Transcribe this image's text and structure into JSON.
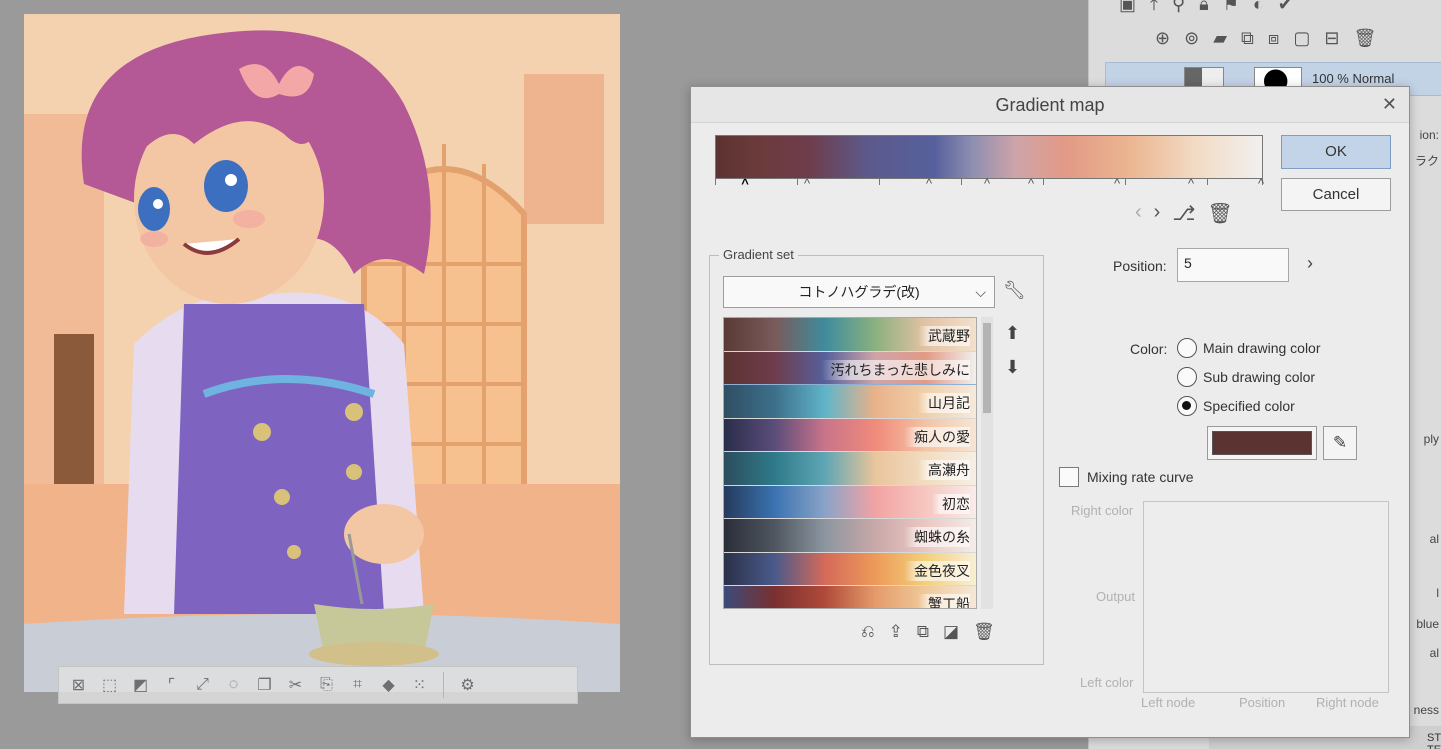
{
  "dialog": {
    "title": "Gradient map",
    "close_label": "✕",
    "ok_label": "OK",
    "cancel_label": "Cancel",
    "node_tools": {
      "prev": "‹",
      "next": "›",
      "add_icon": "add-node-icon",
      "delete_icon": "delete-node-icon"
    },
    "gradient_set": {
      "legend": "Gradient set",
      "selected_set": "コトノハグラデ(改)",
      "items": [
        {
          "label": "武蔵野",
          "colors": [
            "#5a3a35",
            "#7a5a5a",
            "#3f8c9d",
            "#8bb07f",
            "#e3c2a3",
            "#f2e1cc"
          ]
        },
        {
          "label": "汚れちまった悲しみに",
          "colors": [
            "#5b3331",
            "#6e3d4c",
            "#56609c",
            "#cfa4a8",
            "#e29a86",
            "#f1f0ee"
          ]
        },
        {
          "label": "山月記",
          "colors": [
            "#2f4f63",
            "#3d6f8a",
            "#5fb4c8",
            "#eab28a",
            "#f0cfa9",
            "#f5eadc"
          ]
        },
        {
          "label": "痴人の愛",
          "colors": [
            "#2a2d4a",
            "#5a4d7a",
            "#c9748a",
            "#f08b7b",
            "#f3c3a4",
            "#f5e6d5"
          ]
        },
        {
          "label": "高瀬舟",
          "colors": [
            "#2d4d5c",
            "#2e7a8a",
            "#5fa6b4",
            "#e9c59c",
            "#f2dcc0",
            "#f6efe5"
          ]
        },
        {
          "label": "初恋",
          "colors": [
            "#263a5c",
            "#3a73b0",
            "#8aa3c8",
            "#f2a3a3",
            "#f6c7c0",
            "#f8ecea"
          ]
        },
        {
          "label": "蜘蛛の糸",
          "colors": [
            "#2a2e38",
            "#4f5660",
            "#8c96a0",
            "#c9a8a8",
            "#ebc7c2",
            "#f4ece8"
          ]
        },
        {
          "label": "金色夜叉",
          "colors": [
            "#2a3048",
            "#4a5a8a",
            "#d46a5a",
            "#ed9a5a",
            "#f3cf7a",
            "#f8efd5"
          ]
        },
        {
          "label": "蟹工船",
          "colors": [
            "#3a4c7a",
            "#7a3030",
            "#b04a3a",
            "#e59b6a",
            "#f0c99a",
            "#f5e8d8"
          ]
        }
      ]
    },
    "position": {
      "label": "Position:",
      "value": "5"
    },
    "color": {
      "label": "Color:",
      "options": [
        "Main drawing color",
        "Sub drawing color",
        "Specified color"
      ],
      "selected": "Specified color",
      "specified_hex": "#5b3331"
    },
    "mixing_rate_curve": {
      "label": "Mixing rate curve",
      "checked": false,
      "right_color": "Right color",
      "output": "Output",
      "left_color": "Left color",
      "left_node": "Left node",
      "position": "Position",
      "right_node": "Right node"
    }
  },
  "layer_panel": {
    "selected_layer_text": "100 % Normal",
    "edge_labels": [
      "ion:",
      "ラク",
      "ply",
      "al",
      "al",
      "l",
      "blue",
      "al",
      "ness"
    ],
    "bottom_layer_text": "STONE TEXTURE"
  }
}
